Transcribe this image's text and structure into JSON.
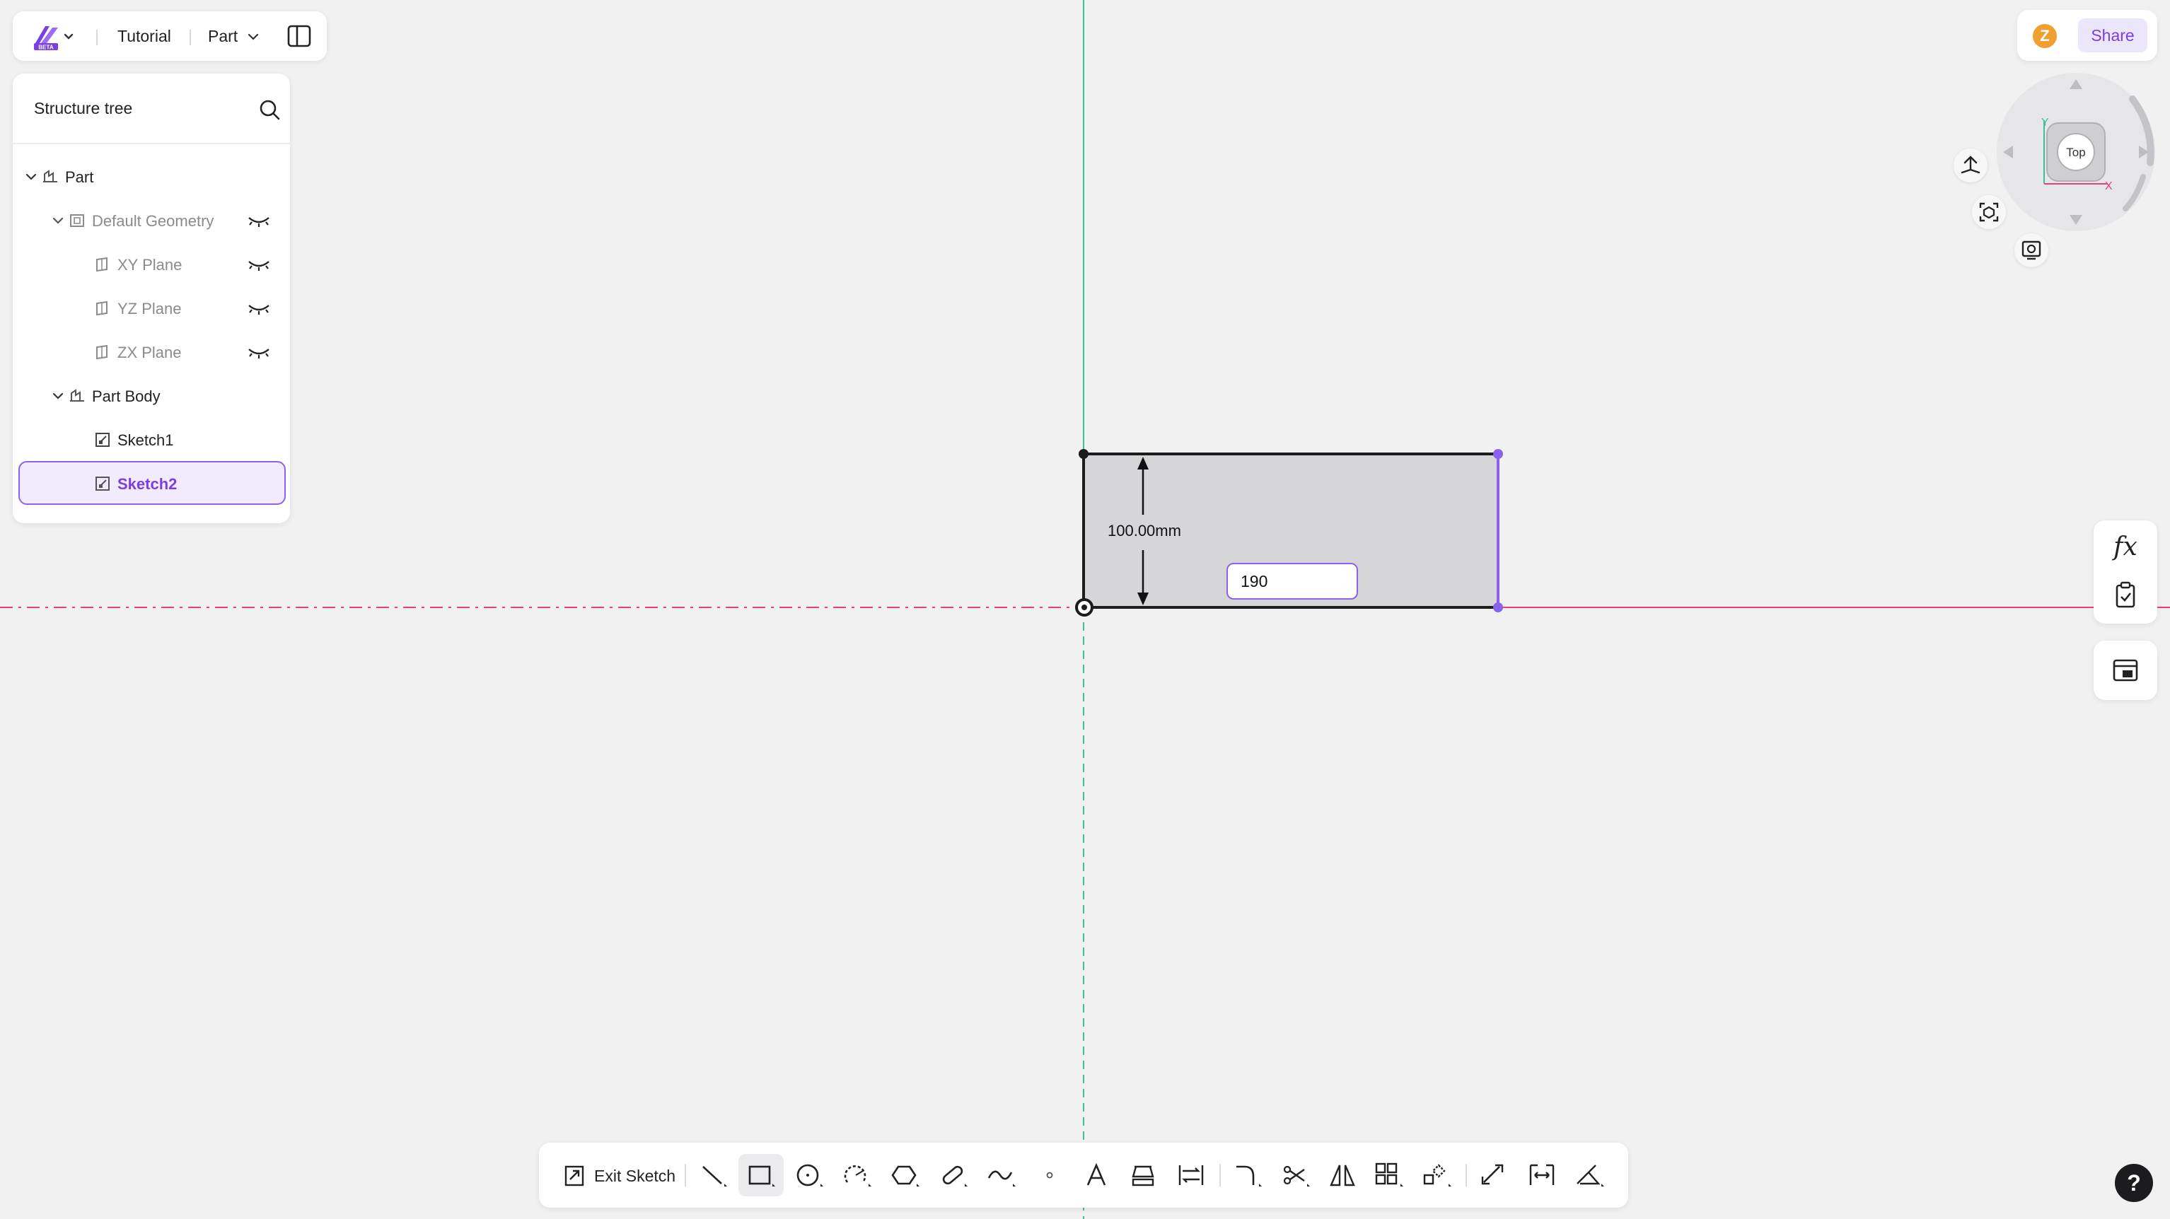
{
  "header": {
    "logo_badge": "BETA",
    "project_name": "Tutorial",
    "mode_label": "Part"
  },
  "tree": {
    "title": "Structure tree",
    "items": [
      {
        "label": "Part"
      },
      {
        "label": "Default Geometry"
      },
      {
        "label": "XY Plane"
      },
      {
        "label": "YZ Plane"
      },
      {
        "label": "ZX Plane"
      },
      {
        "label": "Part Body"
      },
      {
        "label": "Sketch1"
      },
      {
        "label": "Sketch2"
      }
    ]
  },
  "topright": {
    "avatar_initial": "Z",
    "share_label": "Share"
  },
  "view_cube": {
    "face_label": "Top",
    "axis_x": "X",
    "axis_y": "Y"
  },
  "right_tools": {
    "formula_label": "fx"
  },
  "sketch": {
    "height_dimension": "100.00mm",
    "width_input_value": "190"
  },
  "toolbar": {
    "exit_sketch_label": "Exit Sketch"
  },
  "help": {
    "label": "?"
  },
  "colors": {
    "accent": "#8b62ee",
    "x_axis": "#e8417a",
    "y_axis": "#3dbf9a",
    "sketch_fill": "#d6d6d9"
  },
  "icons": {
    "header": [
      "app-logo-icon",
      "chevron-down-icon",
      "panel-toggle-icon"
    ],
    "tree": [
      "search-icon",
      "eye-closed-icon",
      "plane-icon",
      "body-icon",
      "sketch-icon"
    ],
    "toolbar": [
      "line-icon",
      "rectangle-icon",
      "circle-icon",
      "arc-icon",
      "polygon-icon",
      "slot-icon",
      "spline-icon",
      "point-icon",
      "text-icon",
      "project-icon",
      "convert-icon",
      "fillet-icon",
      "trim-icon",
      "mirror-icon",
      "pattern-icon",
      "transform-icon",
      "offset-icon",
      "dimension-icon",
      "constraint-icon"
    ]
  }
}
